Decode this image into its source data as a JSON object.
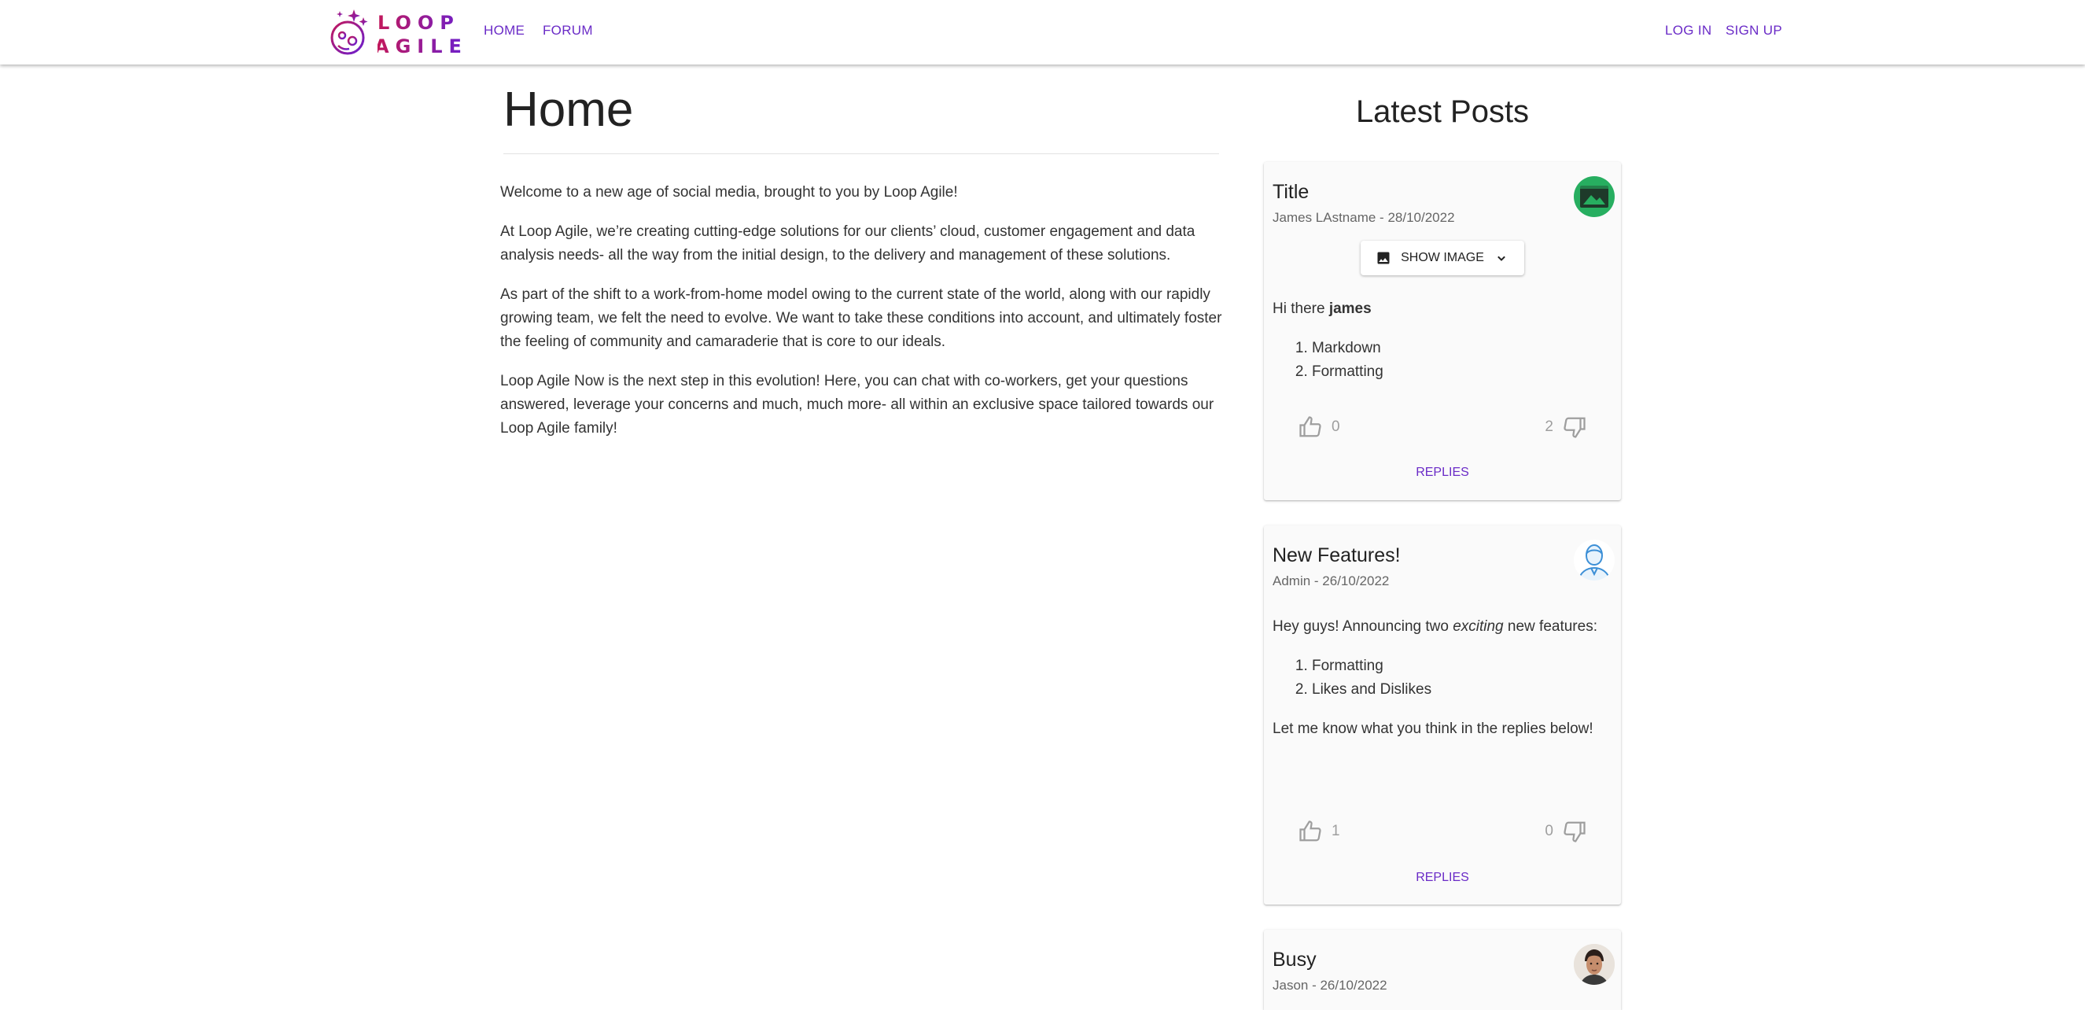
{
  "brand": {
    "line1": "LOOP",
    "line2": "AGILE",
    "gradient_start": "#c2185b",
    "gradient_end": "#6a1fd1"
  },
  "nav": {
    "home": "HOME",
    "forum": "FORUM",
    "login": "LOG IN",
    "signup": "SIGN UP",
    "link_color": "#6a2bc7"
  },
  "main": {
    "title": "Home",
    "paragraphs": [
      "Welcome to a new age of social media, brought to you by Loop Agile!",
      "At Loop Agile, we’re creating cutting-edge solutions for our clients’ cloud, customer engagement and data analysis needs- all the way from the initial design, to the delivery and management of these solutions.",
      "As part of the shift to a work-from-home model owing to the current state of the world, along with our rapidly growing team, we felt the need to evolve. We want to take these conditions into account, and ultimately foster the feeling of community and camaraderie that is core to our ideals.",
      "Loop Agile Now is the next step in this evolution! Here, you can chat with co-workers, get your questions answered, leverage your concerns and much, much more- all within an exclusive space tailored towards our Loop Agile family!"
    ]
  },
  "sidebar": {
    "title": "Latest Posts",
    "posts": [
      {
        "title": "Title",
        "meta": "James LAstname - 28/10/2022",
        "avatar_icon": "image-placeholder-icon",
        "show_image": "SHOW IMAGE",
        "body_prefix": "Hi there ",
        "body_bold": "james",
        "list": [
          "Markdown",
          "Formatting"
        ],
        "likes": "0",
        "dislikes": "2",
        "replies": "REPLIES"
      },
      {
        "title": "New Features!",
        "meta": "Admin - 26/10/2022",
        "avatar_icon": "user-outline-icon",
        "intro_a": "Hey guys! Announcing two ",
        "intro_em": "exciting",
        "intro_b": " new features:",
        "list": [
          "Formatting",
          "Likes and Dislikes"
        ],
        "outro": "Let me know what you think in the replies below!",
        "likes": "1",
        "dislikes": "0",
        "replies": "REPLIES"
      },
      {
        "title": "Busy",
        "meta": "Jason - 26/10/2022",
        "avatar_icon": "person-photo-icon"
      }
    ]
  }
}
